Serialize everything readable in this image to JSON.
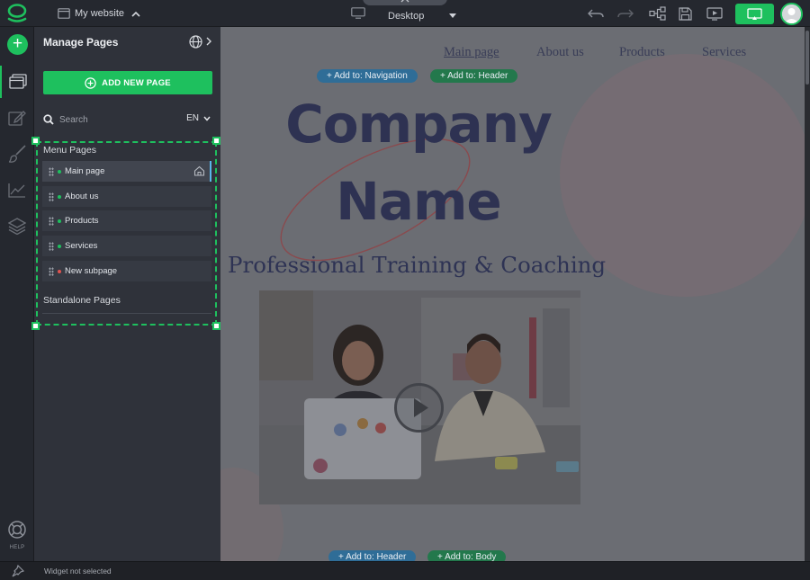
{
  "topbar": {
    "site_name": "My website",
    "device_label": "Desktop",
    "icons": [
      "undo-icon",
      "redo-icon",
      "sitemap-icon",
      "save-icon",
      "preview-icon",
      "publish-icon"
    ]
  },
  "rail": {
    "help_label": "HELP",
    "items": [
      "pages-icon",
      "edit-icon",
      "design-brush-icon",
      "statistics-icon",
      "layers-icon"
    ]
  },
  "panel": {
    "title": "Manage Pages",
    "add_page_label": "ADD NEW PAGE",
    "search_placeholder": "Search",
    "language": "EN",
    "menu_pages_label": "Menu Pages",
    "menu_pages": [
      {
        "label": "Main page",
        "status": "published",
        "selected": true,
        "home": true
      },
      {
        "label": "About us",
        "status": "published"
      },
      {
        "label": "Products",
        "status": "published"
      },
      {
        "label": "Services",
        "status": "published"
      },
      {
        "label": "New subpage",
        "status": "unpublished"
      }
    ],
    "standalone_label": "Standalone Pages"
  },
  "canvas": {
    "nav": [
      "Main page",
      "About us",
      "Products",
      "Services"
    ],
    "add_navigation": "+ Add to: Navigation",
    "add_header_top": "+ Add to: Header",
    "company_line1": "Company",
    "company_line2": "Name",
    "tagline": "Professional Training & Coaching",
    "add_header_bottom": "+ Add to: Header",
    "add_body": "+ Add to: Body"
  },
  "status_bar": {
    "text": "Widget not selected"
  },
  "colors": {
    "accent_green": "#1ec05e",
    "published_dot": "#1ec05e",
    "unpublished_dot": "#e0534f",
    "panel_bg": "#2f323a",
    "title_navy": "#2e3252"
  }
}
